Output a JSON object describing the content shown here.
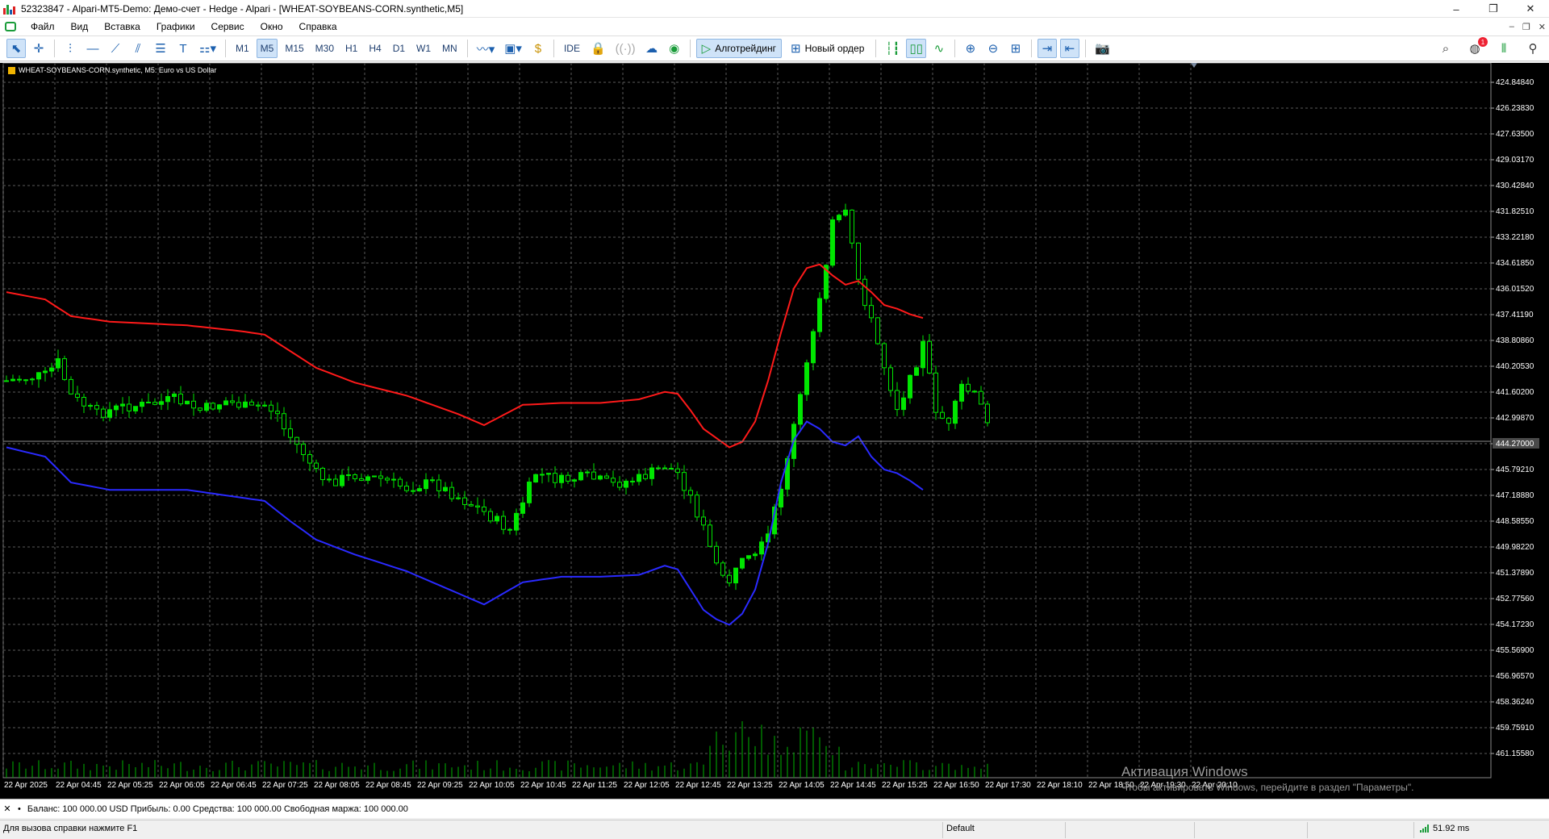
{
  "window": {
    "title": "52323847 - Alpari-MT5-Demo: Демо-счет - Hedge - Alpari - [WHEAT-SOYBEANS-CORN.synthetic,M5]",
    "controls": [
      "–",
      "❐",
      "✕"
    ]
  },
  "menu": {
    "items": [
      "Файл",
      "Вид",
      "Вставка",
      "Графики",
      "Сервис",
      "Окно",
      "Справка"
    ],
    "mdi_controls": [
      "–",
      "❐",
      "✕"
    ]
  },
  "toolbar": {
    "timeframes": [
      "M1",
      "M5",
      "M15",
      "M30",
      "H1",
      "H4",
      "D1",
      "W1",
      "MN"
    ],
    "active_timeframe": "M5",
    "ide_label": "IDE",
    "algo_label": "Алготрейдинг",
    "new_order_label": "Новый ордер",
    "notification_count": "1",
    "colors": {
      "icon": "#1b5fae",
      "active_bg": "#cfe3f8",
      "algo_green": "#1a9c3a"
    }
  },
  "chart": {
    "symbol_label": "WHEAT-SOYBEANS-CORN.synthetic, M5:  Euro vs US Dollar",
    "current_price_label": "444.27000",
    "colors": {
      "background": "#000000",
      "grid": "#5a5a5a",
      "candles": "#00e600",
      "volumes": "#00b300",
      "upper_band": "#ff1a1a",
      "lower_band": "#2a2aff",
      "axis_text": "#ffffff"
    }
  },
  "chart_data": {
    "type": "candlestick",
    "y_axis": {
      "inverted": true,
      "ticks": [
        "424.84840",
        "426.23830",
        "427.63500",
        "429.03170",
        "430.42840",
        "431.82510",
        "433.22180",
        "434.61850",
        "436.01520",
        "437.41190",
        "438.80860",
        "440.20530",
        "441.60200",
        "442.99870",
        "444.27000",
        "445.79210",
        "447.18880",
        "448.58550",
        "449.98220",
        "451.37890",
        "452.77560",
        "454.17230",
        "455.56900",
        "456.96570",
        "458.36240",
        "459.75910",
        "461.15580"
      ]
    },
    "x_axis": {
      "ticks": [
        "22 Apr 2025",
        "22 Apr 04:45",
        "22 Apr 05:25",
        "22 Apr 06:05",
        "22 Apr 06:45",
        "22 Apr 07:25",
        "22 Apr 08:05",
        "22 Apr 08:45",
        "22 Apr 09:25",
        "22 Apr 10:05",
        "22 Apr 10:45",
        "22 Apr 11:25",
        "22 Apr 12:05",
        "22 Apr 12:45",
        "22 Apr 13:25",
        "22 Apr 14:05",
        "22 Apr 14:45",
        "22 Apr 15:25",
        "22 Apr 16:50",
        "22 Apr 17:30",
        "22 Apr 18:10",
        "22 Apr 18:50",
        "22 Apr 19:30",
        "22 Apr 20:10"
      ]
    },
    "close_path": [
      [
        0,
        441.0
      ],
      [
        6,
        440.7
      ],
      [
        8,
        440.0
      ],
      [
        10,
        441.8
      ],
      [
        14,
        442.8
      ],
      [
        18,
        442.4
      ],
      [
        22,
        442.3
      ],
      [
        26,
        442.0
      ],
      [
        30,
        442.6
      ],
      [
        34,
        442.1
      ],
      [
        38,
        442.5
      ],
      [
        40,
        442.3
      ],
      [
        42,
        442.8
      ],
      [
        43,
        443.6
      ],
      [
        46,
        444.9
      ],
      [
        48,
        446.0
      ],
      [
        50,
        446.5
      ],
      [
        54,
        446.1
      ],
      [
        58,
        446.3
      ],
      [
        62,
        446.8
      ],
      [
        66,
        446.5
      ],
      [
        70,
        447.3
      ],
      [
        74,
        448.1
      ],
      [
        76,
        448.6
      ],
      [
        78,
        449.1
      ],
      [
        82,
        446.0
      ],
      [
        86,
        446.4
      ],
      [
        90,
        446.2
      ],
      [
        94,
        446.6
      ],
      [
        98,
        446.3
      ],
      [
        102,
        445.6
      ],
      [
        104,
        446.0
      ],
      [
        106,
        447.3
      ],
      [
        108,
        449.0
      ],
      [
        110,
        451.1
      ],
      [
        112,
        451.8
      ],
      [
        114,
        450.9
      ],
      [
        116,
        450.6
      ],
      [
        118,
        449.4
      ],
      [
        120,
        446.7
      ],
      [
        122,
        443.5
      ],
      [
        124,
        440.2
      ],
      [
        126,
        436.4
      ],
      [
        128,
        432.5
      ],
      [
        130,
        432.0
      ],
      [
        132,
        435.5
      ],
      [
        134,
        437.8
      ],
      [
        136,
        440.2
      ],
      [
        138,
        442.4
      ],
      [
        140,
        441.0
      ],
      [
        142,
        439.0
      ],
      [
        144,
        442.5
      ],
      [
        146,
        443.5
      ],
      [
        148,
        441.3
      ],
      [
        150,
        441.8
      ],
      [
        152,
        443.0
      ]
    ],
    "upper_band": [
      [
        0,
        436.2
      ],
      [
        6,
        436.6
      ],
      [
        10,
        437.5
      ],
      [
        16,
        437.8
      ],
      [
        22,
        437.9
      ],
      [
        28,
        438.0
      ],
      [
        36,
        438.3
      ],
      [
        40,
        438.5
      ],
      [
        44,
        439.4
      ],
      [
        48,
        440.3
      ],
      [
        54,
        441.1
      ],
      [
        62,
        441.8
      ],
      [
        70,
        442.8
      ],
      [
        74,
        443.4
      ],
      [
        80,
        442.3
      ],
      [
        86,
        442.2
      ],
      [
        92,
        442.2
      ],
      [
        98,
        442.0
      ],
      [
        102,
        441.6
      ],
      [
        104,
        441.7
      ],
      [
        106,
        442.6
      ],
      [
        108,
        443.6
      ],
      [
        110,
        444.1
      ],
      [
        112,
        444.6
      ],
      [
        114,
        444.3
      ],
      [
        116,
        443.2
      ],
      [
        118,
        441.0
      ],
      [
        120,
        438.4
      ],
      [
        122,
        436.0
      ],
      [
        124,
        434.9
      ],
      [
        126,
        434.7
      ],
      [
        128,
        435.3
      ],
      [
        130,
        435.8
      ],
      [
        132,
        435.6
      ],
      [
        134,
        436.2
      ],
      [
        136,
        436.9
      ],
      [
        138,
        437.1
      ],
      [
        140,
        437.4
      ],
      [
        142,
        437.6
      ]
    ],
    "lower_band": [
      [
        0,
        444.6
      ],
      [
        6,
        445.1
      ],
      [
        10,
        446.5
      ],
      [
        16,
        446.9
      ],
      [
        22,
        446.9
      ],
      [
        28,
        446.9
      ],
      [
        36,
        447.3
      ],
      [
        40,
        447.5
      ],
      [
        44,
        448.6
      ],
      [
        48,
        449.6
      ],
      [
        54,
        450.4
      ],
      [
        62,
        451.3
      ],
      [
        70,
        452.5
      ],
      [
        74,
        453.1
      ],
      [
        80,
        451.9
      ],
      [
        86,
        451.6
      ],
      [
        92,
        451.6
      ],
      [
        98,
        451.5
      ],
      [
        102,
        451.0
      ],
      [
        104,
        451.2
      ],
      [
        106,
        452.3
      ],
      [
        108,
        453.4
      ],
      [
        110,
        453.9
      ],
      [
        112,
        454.2
      ],
      [
        114,
        453.6
      ],
      [
        116,
        452.3
      ],
      [
        118,
        449.8
      ],
      [
        120,
        446.5
      ],
      [
        122,
        444.2
      ],
      [
        124,
        443.2
      ],
      [
        126,
        443.6
      ],
      [
        128,
        444.3
      ],
      [
        130,
        444.5
      ],
      [
        132,
        444.0
      ],
      [
        134,
        445.1
      ],
      [
        136,
        445.8
      ],
      [
        138,
        446.0
      ],
      [
        140,
        446.4
      ],
      [
        142,
        446.9
      ]
    ]
  },
  "trade_panel": {
    "account_text": "Баланс: 100 000.00 USD  Прибыль: 0.00  Средства: 100 000.00  Свободная маржа: 100 000.00"
  },
  "status": {
    "help_text": "Для вызова справки нажмите F1",
    "profile": "Default",
    "ping": "51.92 ms"
  },
  "watermark": {
    "line1": "Активация Windows",
    "line2": "Чтобы активировать Windows, перейдите в раздел \"Параметры\"."
  }
}
